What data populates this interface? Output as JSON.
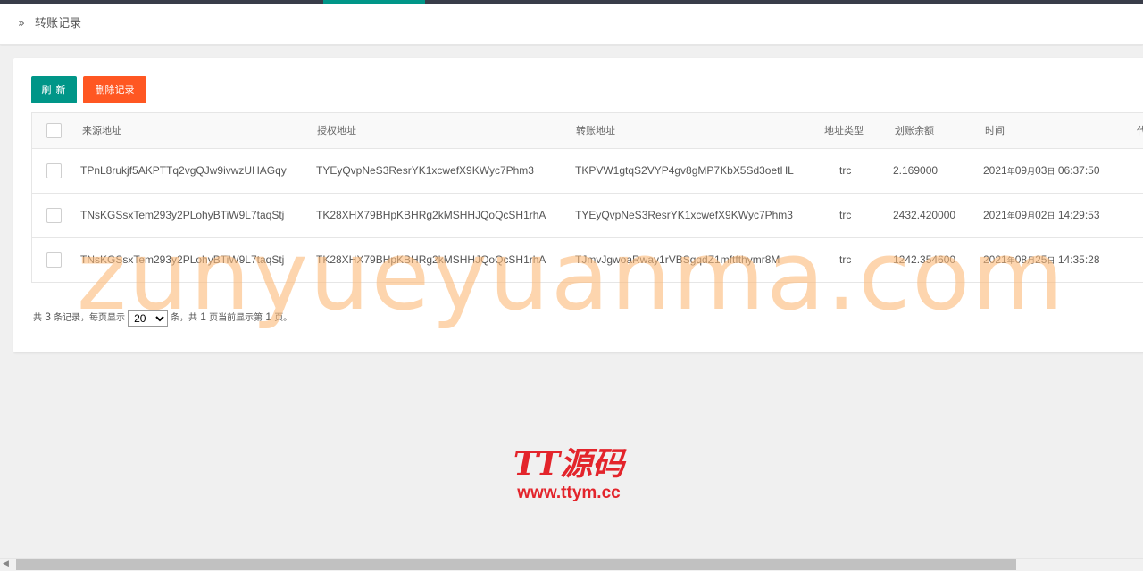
{
  "breadcrumb": {
    "icon": "»",
    "title": "转账记录"
  },
  "toolbar": {
    "refresh_label": "刷新",
    "delete_label": "删除记录"
  },
  "table": {
    "columns": [
      "来源地址",
      "授权地址",
      "转账地址",
      "地址类型",
      "划账余额",
      "时间",
      "代"
    ],
    "rows": [
      {
        "source": "TPnL8rukjf5AKPTTq2vgQJw9ivwzUHAGqy",
        "auth": "TYEyQvpNeS3ResrYK1xcwefX9KWyc7Phm3",
        "transfer": "TKPVW1gtqS2VYP4gv8gMP7KbX5Sd3oetHL",
        "type": "trc",
        "balance": "2.169000",
        "time_year": "2021",
        "time_month": "09",
        "time_day": "03",
        "time_clock": "06:37:50"
      },
      {
        "source": "TNsKGSsxTem293y2PLohyBTiW9L7taqStj",
        "auth": "TK28XHX79BHpKBHRg2kMSHHJQoQcSH1rhA",
        "transfer": "TYEyQvpNeS3ResrYK1xcwefX9KWyc7Phm3",
        "type": "trc",
        "balance": "2432.420000",
        "time_year": "2021",
        "time_month": "09",
        "time_day": "02",
        "time_clock": "14:29:53"
      },
      {
        "source": "TNsKGSsxTem293y2PLohyBTiW9L7taqStj",
        "auth": "TK28XHX79BHpKBHRg2kMSHHJQoQcSH1rhA",
        "transfer": "TJmvJgwoaRway1rVBSgqdZ1mftfthymr8M",
        "type": "trc",
        "balance": "1242.354600",
        "time_year": "2021",
        "time_month": "08",
        "time_day": "25",
        "time_clock": "14:35:28"
      }
    ],
    "date_units": {
      "year": "年",
      "month": "月",
      "day": "日"
    }
  },
  "pager": {
    "prefix": "共",
    "total": "3",
    "mid1": "条记录，每页显示",
    "per_page": "20",
    "mid2": "条，共",
    "pages": "1",
    "mid3": "页当前显示第",
    "current": "1",
    "suffix": "页。"
  },
  "watermark": "zunyueyuanma.com",
  "logo": {
    "title": "TT源码",
    "url": "www.ttym.cc"
  },
  "colors": {
    "primary": "#009688",
    "danger": "#ff5722",
    "logo": "#e3242b"
  }
}
